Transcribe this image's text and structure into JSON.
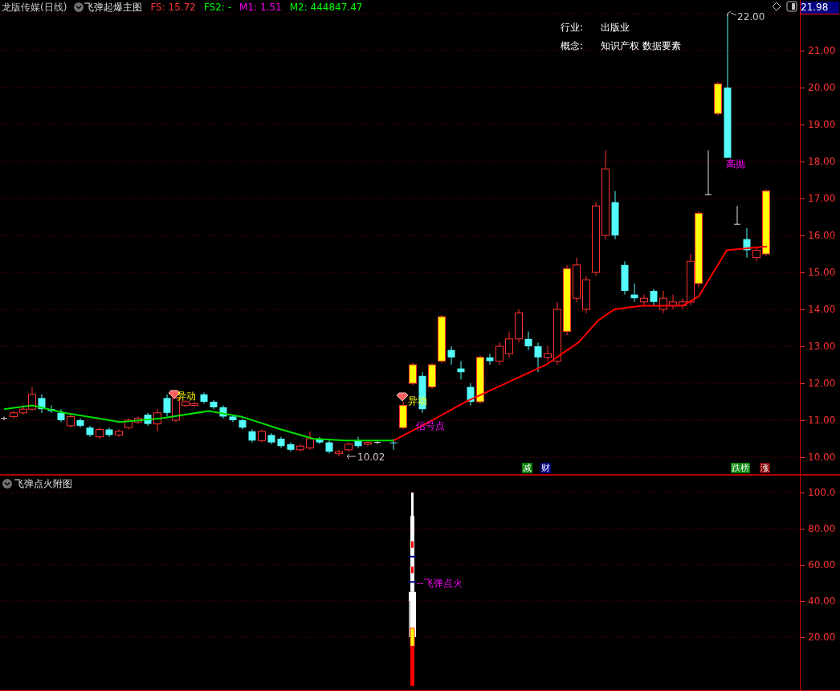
{
  "header": {
    "stock": "龙版传媒(日线)",
    "indicator": "飞弹起爆主图",
    "readings": [
      {
        "label": "FS:",
        "value": "15.72",
        "color": "#ff3232"
      },
      {
        "label": "FS2:",
        "value": "-",
        "color": "#00ff00"
      },
      {
        "label": "M1:",
        "value": "1.51",
        "color": "#ff00ff"
      },
      {
        "label": "M2:",
        "value": "444847.47",
        "color": "#00ff00"
      }
    ]
  },
  "info": [
    {
      "label": "行业:",
      "value": "出版业"
    },
    {
      "label": "概念:",
      "value": "知识产权 数据要素"
    }
  ],
  "current_price": "21.98",
  "price_axis": [
    "21.00",
    "20.00",
    "19.00",
    "18.00",
    "17.00",
    "16.00",
    "15.00",
    "14.00",
    "13.00",
    "12.00",
    "11.00",
    "10.00"
  ],
  "annotations": [
    {
      "text": "异动",
      "kind": "signal"
    },
    {
      "text": "异动",
      "kind": "signal"
    },
    {
      "text": "信号点",
      "kind": "note"
    },
    {
      "text": "高抛",
      "kind": "note"
    }
  ],
  "price_marks": [
    {
      "text": "10.02",
      "kind": "low"
    },
    {
      "text": "22.00",
      "kind": "high"
    }
  ],
  "tags": [
    {
      "text": "减",
      "color": "#008000"
    },
    {
      "text": "财",
      "color": "#000080"
    },
    {
      "text": "跌榜",
      "color": "#008000"
    },
    {
      "text": "涨",
      "color": "#800000"
    }
  ],
  "sub_panel": {
    "title": "飞弹点火附图",
    "label": "--飞弹点火",
    "axis": [
      "100.0",
      "80.00",
      "60.00",
      "40.00",
      "20.00"
    ]
  }
}
